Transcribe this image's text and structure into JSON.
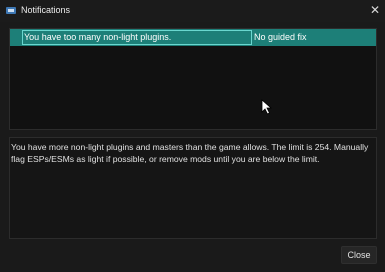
{
  "window": {
    "title": "Notifications",
    "close_glyph": "✕"
  },
  "notifications": [
    {
      "message": "You have too many non-light plugins.",
      "fix": "No guided fix"
    }
  ],
  "details": {
    "text": "You have more non-light plugins and masters than the game allows. The limit is 254. Manually flag ESPs/ESMs as light if possible, or remove mods until you are below the limit."
  },
  "buttons": {
    "close_label": "Close"
  },
  "colors": {
    "selected_row": "#1d7f78",
    "focus_border": "#6ad7cf",
    "background": "#1a1a1a"
  }
}
